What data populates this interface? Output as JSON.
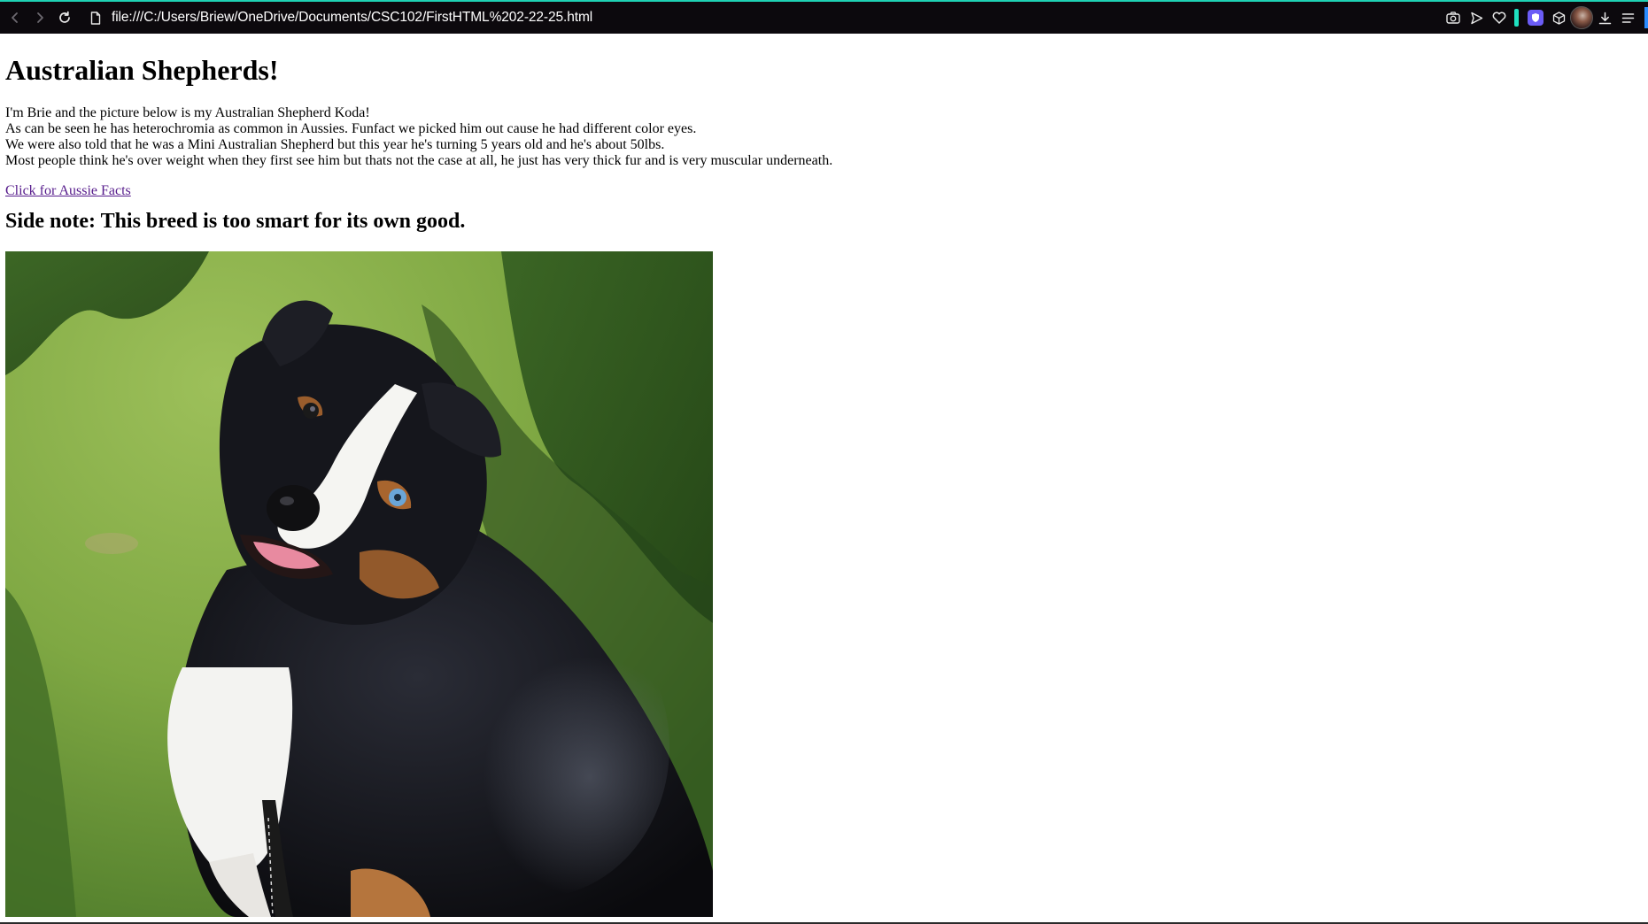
{
  "browser": {
    "url": "file:///C:/Users/Briew/OneDrive/Documents/CSC102/FirstHTML%202-22-25.html",
    "accent_color": "#1fd1b4",
    "toolbar_color": "#0c090d",
    "nav_icons": [
      "back-icon",
      "forward-icon",
      "reload-icon"
    ],
    "right_icons": [
      "camera-icon",
      "send-icon",
      "heart-icon",
      "extension-shield-icon",
      "cube-icon",
      "avatar",
      "download-icon",
      "menu-icon"
    ]
  },
  "page": {
    "title": "Australian Shepherds!",
    "paragraph_lines": [
      "I'm Brie and the picture below is my Australian Shepherd Koda!",
      "As can be seen he has heterochromia as common in Aussies. Funfact we picked him out cause he had different color eyes.",
      "We were also told that he was a Mini Australian Shepherd but this year he's turning 5 years old and he's about 50lbs.",
      "Most people think he's over weight when they first see him but thats not the case at all, he just has very thick fur and is very muscular underneath."
    ],
    "link_text": "Click for Aussie Facts",
    "link_color": "#551a8b",
    "side_note": "Side note: This breed is too smart for its own good.",
    "image_subject": "Australian Shepherd dog sitting on grass"
  }
}
